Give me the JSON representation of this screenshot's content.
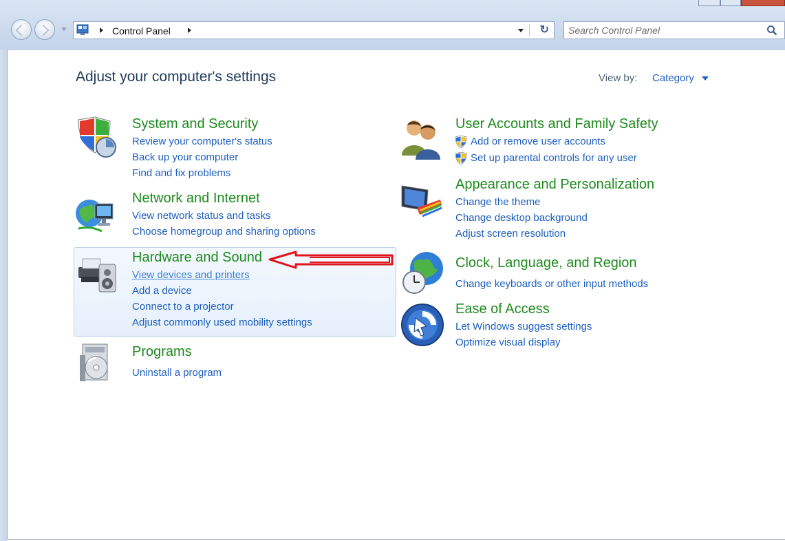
{
  "window": {
    "address_path": [
      "Control Panel"
    ],
    "search_placeholder": "Search Control Panel"
  },
  "page": {
    "heading": "Adjust your computer's settings",
    "view_by_label": "View by:",
    "view_by_value": "Category"
  },
  "categories_left": [
    {
      "title": "System and Security",
      "icon": "shield-icon",
      "links": [
        "Review your computer's status",
        "Back up your computer",
        "Find and fix problems"
      ]
    },
    {
      "title": "Network and Internet",
      "icon": "network-globe-icon",
      "links": [
        "View network status and tasks",
        "Choose homegroup and sharing options"
      ]
    },
    {
      "title": "Hardware and Sound",
      "icon": "printer-speaker-icon",
      "links": [
        "View devices and printers",
        "Add a device",
        "Connect to a projector",
        "Adjust commonly used mobility settings"
      ]
    },
    {
      "title": "Programs",
      "icon": "programs-disc-icon",
      "links": [
        "Uninstall a program"
      ]
    }
  ],
  "categories_right": [
    {
      "title": "User Accounts and Family Safety",
      "icon": "users-icon",
      "links": [
        "Add or remove user accounts",
        "Set up parental controls for any user"
      ]
    },
    {
      "title": "Appearance and Personalization",
      "icon": "monitor-palette-icon",
      "links": [
        "Change the theme",
        "Change desktop background",
        "Adjust screen resolution"
      ]
    },
    {
      "title": "Clock, Language, and Region",
      "icon": "clock-globe-icon",
      "links": [
        "Change keyboards or other input methods"
      ]
    },
    {
      "title": "Ease of Access",
      "icon": "ease-of-access-icon",
      "links": [
        "Let Windows suggest settings",
        "Optimize visual display"
      ]
    }
  ],
  "colors": {
    "category_title": "#1e8a1e",
    "link": "#1d5fbf",
    "annotation_arrow": "#e0141a"
  }
}
